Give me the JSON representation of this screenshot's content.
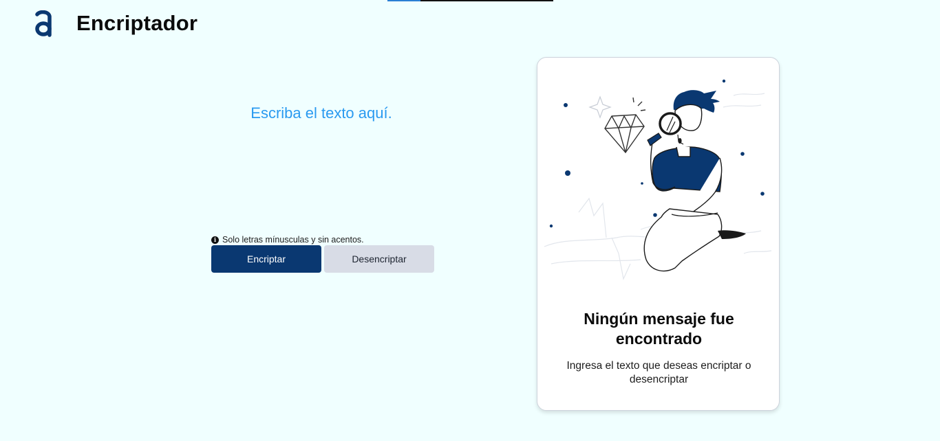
{
  "header": {
    "title": "Encriptador",
    "logo_icon": "alura-logo-icon"
  },
  "editor": {
    "placeholder": "Escriba el texto aquí.",
    "hint_icon": "info-icon",
    "hint_text": "Solo letras mínusculas y sin acentos."
  },
  "actions": {
    "encrypt_label": "Encriptar",
    "decrypt_label": "Desencriptar"
  },
  "output": {
    "illustration": "person-with-magnifier-illustration",
    "title": "Ningún mensaje fue encontrado",
    "message": "Ingresa el texto que deseas encriptar o desencriptar"
  },
  "colors": {
    "background": "#f0ffff",
    "primary": "#0a3871",
    "placeholder": "#2a9af0",
    "secondary_button": "#d8dce6"
  }
}
